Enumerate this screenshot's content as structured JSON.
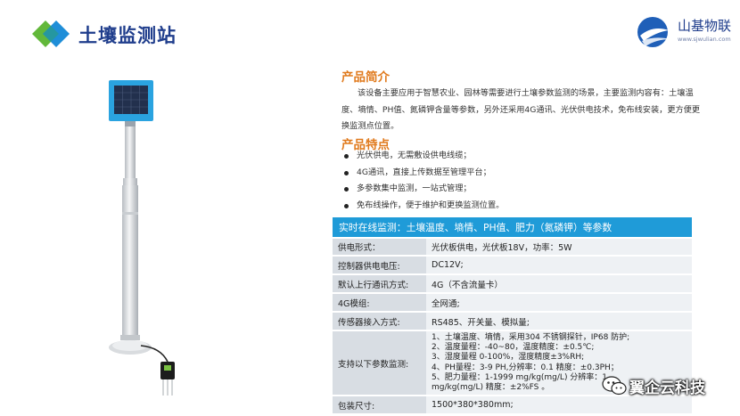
{
  "header": {
    "title": "土壤监测站",
    "brand_name": "山基物联",
    "brand_url": "www.sjwulian.com",
    "colors": {
      "title": "#1f3d8c",
      "logo_green": "#62b83a",
      "logo_blue": "#1f8ed8"
    }
  },
  "intro": {
    "title": "产品简介",
    "text": "该设备主要应用于智慧农业、园林等需要进行土壤参数监测的场景，主要监测内容有：土壤温度、墒情、PH值、氮磷钾含量等参数，另外还采用4G通讯、光伏供电技术，免布线安装，更方便更换监测点位置。"
  },
  "features": {
    "title": "产品特点",
    "items": [
      "光伏供电，无需敷设供电线缆；",
      "4G通讯，直接上传数据至管理平台；",
      "多参数集中监测，一站式管理；",
      "免布线操作，便于维护和更换监测位置。"
    ]
  },
  "specs": {
    "header": "实时在线监测：土壤温度、墒情、PH值、肥力（氮磷钾）等参数",
    "header_color": "#1f9bd8",
    "rows": [
      {
        "label": "供电形式：",
        "value": "光伏板供电，光伏板18V，功率：5W"
      },
      {
        "label": "控制器供电电压:",
        "value": "DC12V;"
      },
      {
        "label": "默认上行通讯方式:",
        "value": "4G（不含流量卡）"
      },
      {
        "label": "4G模组:",
        "value": "全网通;"
      },
      {
        "label": "传感器接入方式:",
        "value": "RS485、开关量、模拟量;"
      }
    ],
    "params_label": "支持以下参数监测:",
    "params_lines": [
      "1、土壤温度、墒情，采用304 不锈钢探针，IP68 防护;",
      "2、温度量程：-40~80，温度精度：±0.5℃;",
      "3、湿度量程 0-100%，湿度精度±3%RH;",
      "4、PH量程：3-9 PH,分辨率：0.1 精度：±0.3PH；",
      "5、肥力量程：1-1999 mg/kg(mg/L) 分辨率：1",
      "mg/kg(mg/L) 精度：±2%FS 。"
    ],
    "size_label": "包装尺寸:",
    "size_value": "1500*380*380mm;"
  },
  "watermark": {
    "text": "翼企云科技"
  }
}
